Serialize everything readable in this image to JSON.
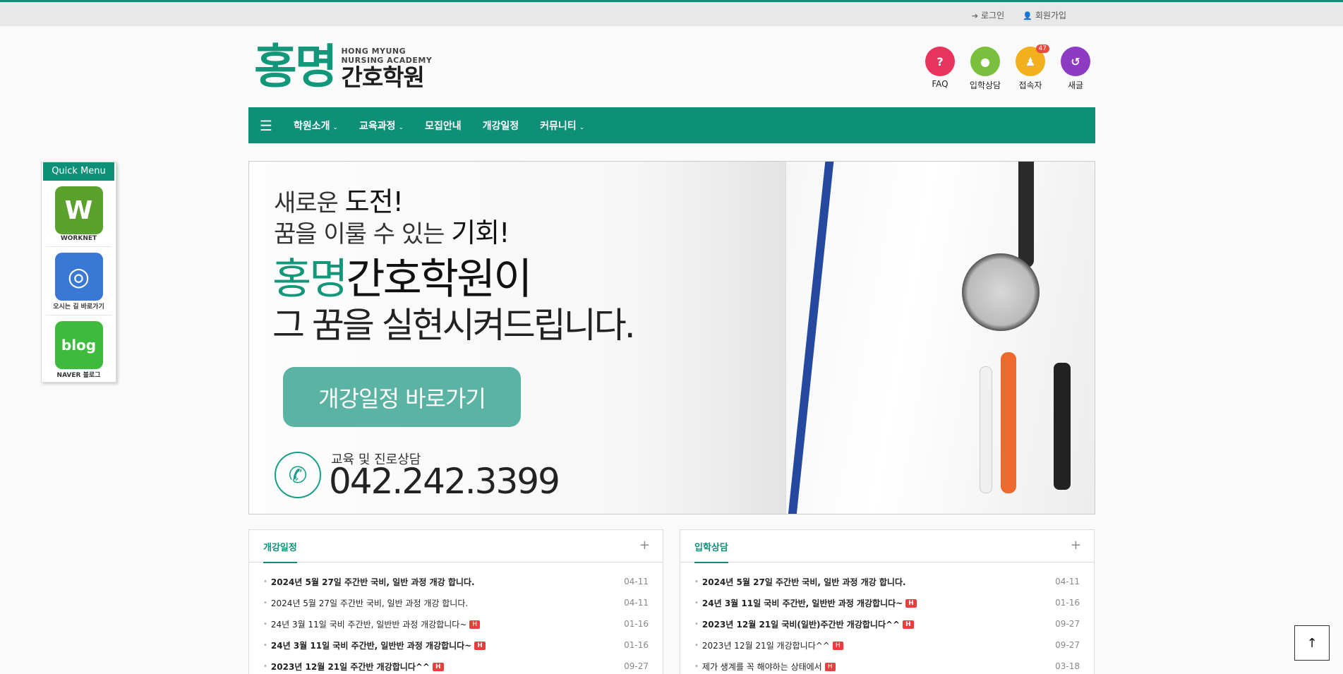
{
  "topbar": {
    "login": "로그인",
    "signup": "회원가입"
  },
  "logo": {
    "big": "홍명",
    "en_line1": "HONG MYUNG",
    "en_line2": "NURSING ACADEMY",
    "ko": "간호학원"
  },
  "shortcuts": [
    {
      "label": "FAQ",
      "icon": "question-icon",
      "color": "#e8335d",
      "glyph": "?"
    },
    {
      "label": "입학상담",
      "icon": "chat-icon",
      "color": "#7bbf3e",
      "glyph": "●"
    },
    {
      "label": "접속자",
      "icon": "users-icon",
      "color": "#f2b01e",
      "glyph": "♟",
      "badge": "47"
    },
    {
      "label": "새글",
      "icon": "refresh-icon",
      "color": "#8e3bc4",
      "glyph": "↺"
    }
  ],
  "nav": {
    "items": [
      "학원소개",
      "교육과정",
      "모집안내",
      "개강일정",
      "커뮤니티"
    ],
    "has_caret": [
      true,
      true,
      false,
      false,
      true
    ]
  },
  "quick_menu": {
    "title": "Quick Menu",
    "items": [
      {
        "name": "worknet",
        "logo_text": "W",
        "caption": "WORKNET",
        "color": "#5aa12e"
      },
      {
        "name": "directions",
        "logo_text": "◎",
        "caption": "오시는 길 바로가기",
        "color": "#3a78d6"
      },
      {
        "name": "blog",
        "logo_text": "blog",
        "caption": "NAVER 블로그",
        "color": "#3dbb3d"
      }
    ]
  },
  "banner": {
    "line1_a": "새로운 ",
    "line1_b": "도전!",
    "line2_a": "꿈을 이룰 수 있는 ",
    "line2_b": "기회!",
    "line3_green": "홍명",
    "line3_rest": "간호학원이",
    "line4": "그 꿈을 실현시켜드립니다.",
    "cta": "개강일정 바로가기",
    "phone_label": "교육 및 진로상담",
    "phone_number": "042.242.3399"
  },
  "boxes": [
    {
      "title": "개강일정",
      "items": [
        {
          "text": "2024년 5월 27일 주간반 국비, 일반 과정 개강 합니다.",
          "date": "04-11",
          "bold": true,
          "new": false
        },
        {
          "text": "2024년 5월 27일 주간반 국비, 일반 과정 개강 합니다.",
          "date": "04-11",
          "bold": false,
          "new": false
        },
        {
          "text": "24년 3월 11일 국비 주간반, 일반반 과정 개강합니다~",
          "date": "01-16",
          "bold": false,
          "new": true
        },
        {
          "text": "24년 3월 11일 국비 주간반, 일반반 과정 개강합니다~",
          "date": "01-16",
          "bold": true,
          "new": true
        },
        {
          "text": "2023년 12월 21일 주간반 개강합니다^^",
          "date": "09-27",
          "bold": true,
          "new": true
        }
      ]
    },
    {
      "title": "입학상담",
      "items": [
        {
          "text": "2024년 5월 27일 주간반 국비, 일반 과정 개강 합니다.",
          "date": "04-11",
          "bold": true,
          "new": false
        },
        {
          "text": "24년 3월 11일 국비 주간반, 일반반 과정 개강합니다~",
          "date": "01-16",
          "bold": true,
          "new": true
        },
        {
          "text": "2023년 12월 21일 국비(일반)주간반 개강합니다^^",
          "date": "09-27",
          "bold": true,
          "new": true
        },
        {
          "text": "2023년 12월 21일 개강합니다^^",
          "date": "09-27",
          "bold": false,
          "new": true
        },
        {
          "text": "제가 생계를 꼭 해야하는 상태에서",
          "date": "03-18",
          "bold": false,
          "new": true
        }
      ]
    }
  ],
  "new_badge": "H",
  "more_glyph": "+",
  "totop_glyph": "↑"
}
